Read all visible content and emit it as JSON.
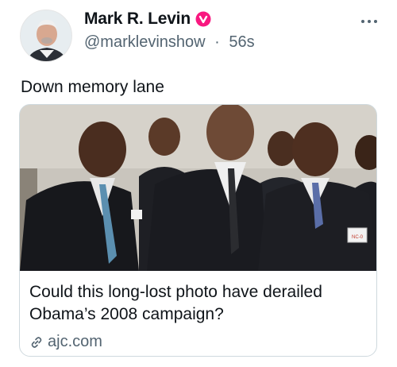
{
  "author": {
    "display_name": "Mark R. Levin",
    "handle": "@marklevinshow",
    "separator": "·",
    "timestamp": "56s",
    "verified_icon": "verified-badge-icon",
    "verified_color": "#f91880"
  },
  "tweet": {
    "text": "Down memory lane"
  },
  "link_card": {
    "title": "Could this long-lost photo have derailed Obama’s 2008 campaign?",
    "domain": "ajc.com",
    "domain_icon": "link-icon",
    "image_badge_left": "",
    "image_badge_right": "NC-0"
  },
  "colors": {
    "text_primary": "#0f1419",
    "text_secondary": "#536471",
    "card_border": "#cfd9de"
  }
}
